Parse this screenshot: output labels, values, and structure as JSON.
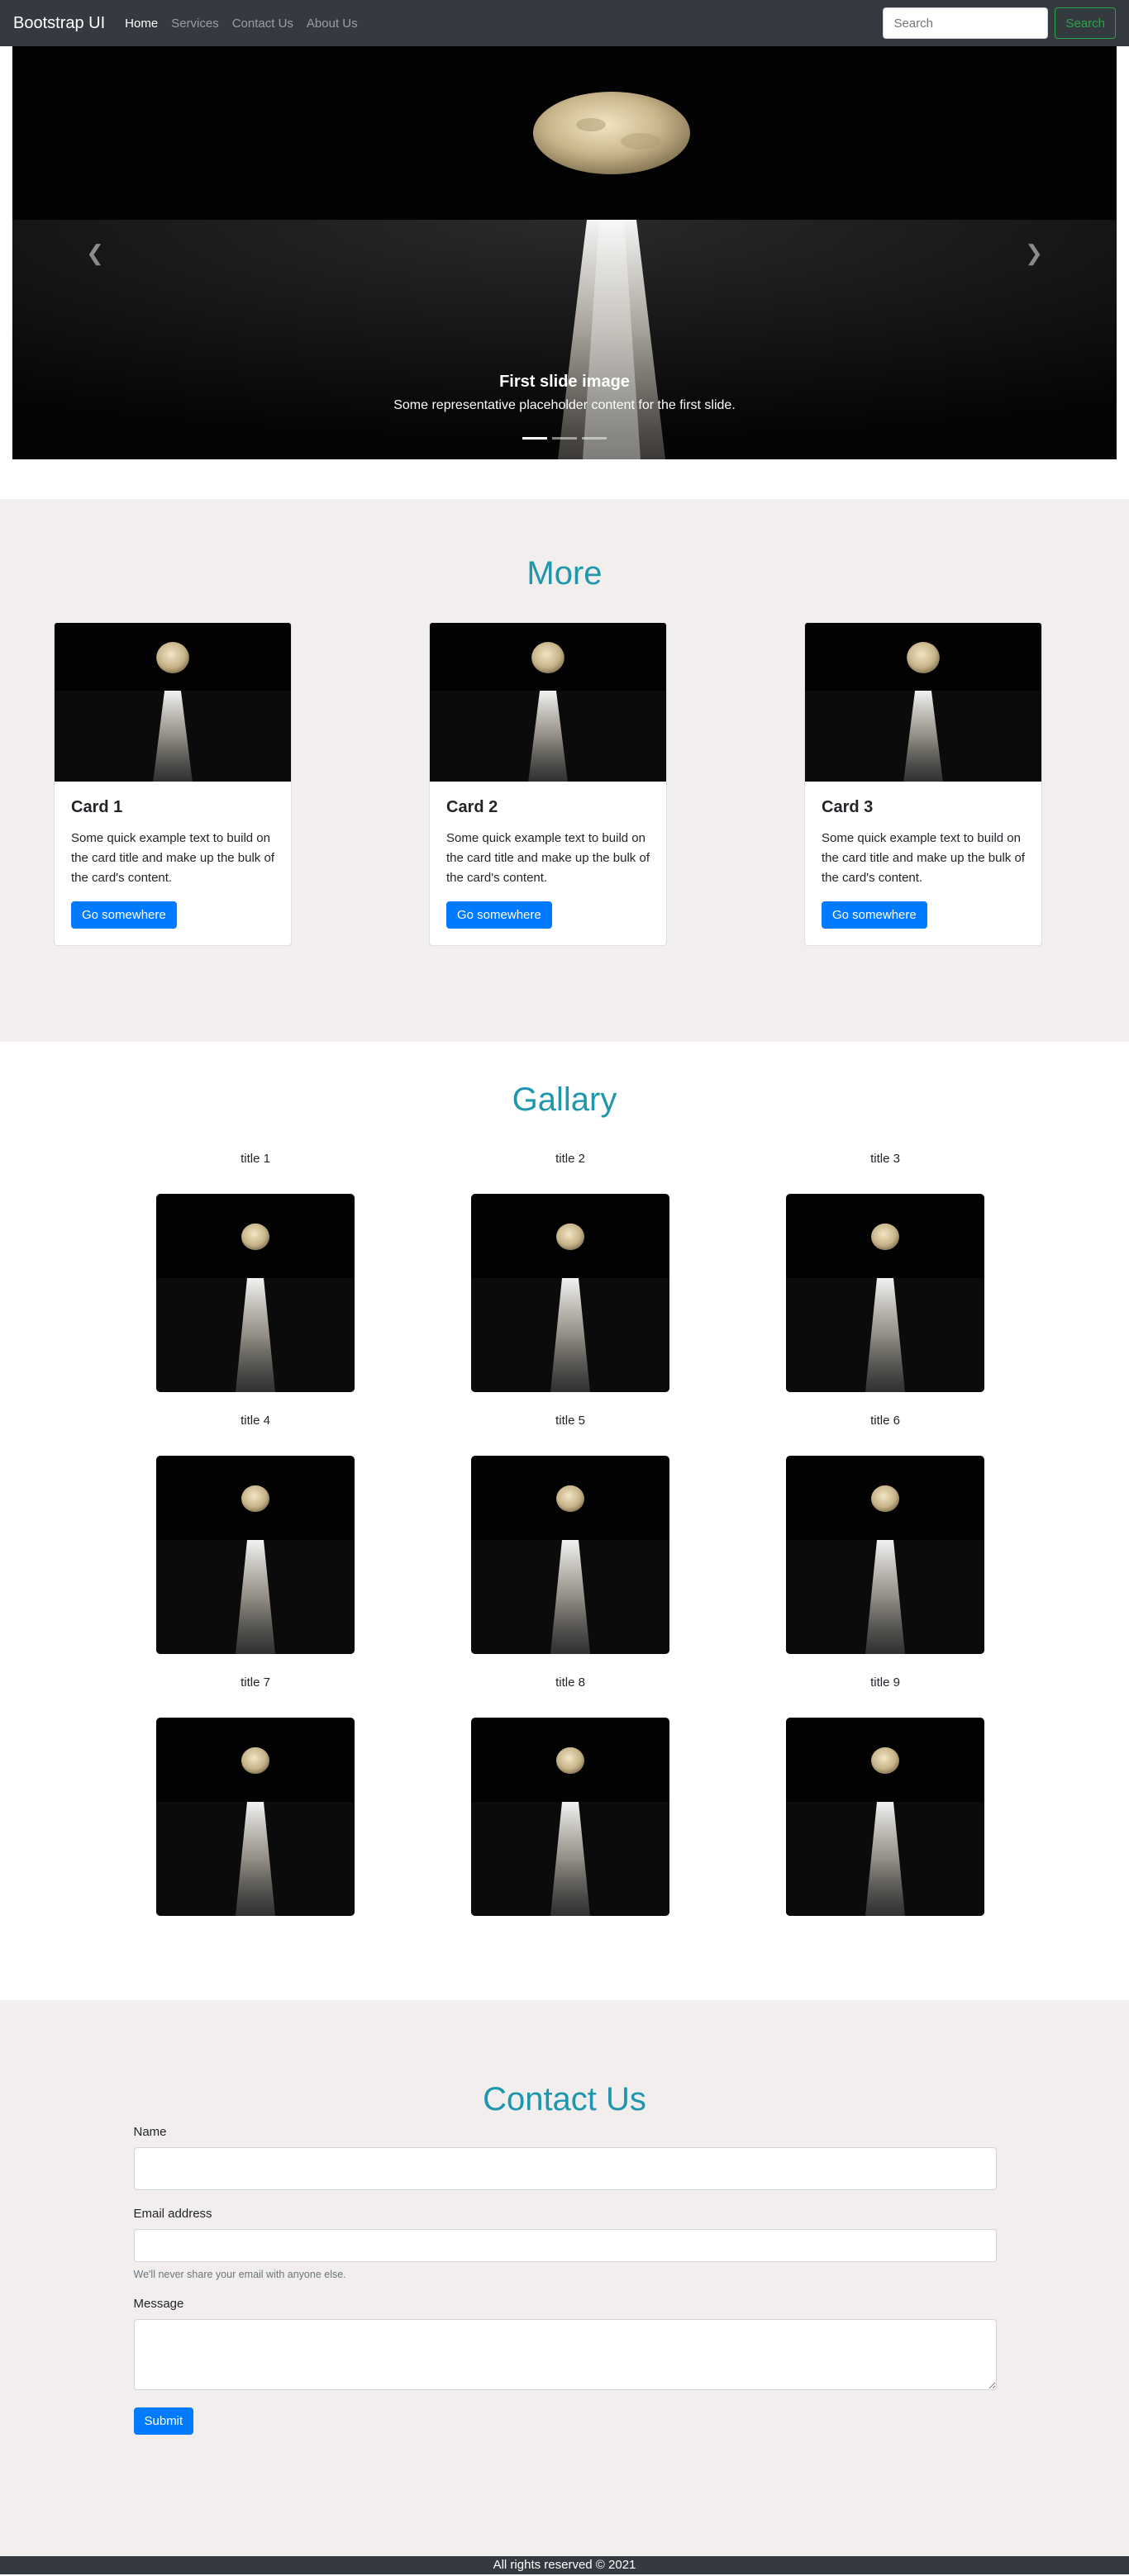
{
  "navbar": {
    "brand": "Bootstrap UI",
    "links": [
      {
        "label": "Home"
      },
      {
        "label": "Services"
      },
      {
        "label": "Contact Us"
      },
      {
        "label": "About Us"
      }
    ],
    "search_placeholder": "Search",
    "search_button": "Search"
  },
  "carousel": {
    "caption_title": "First slide image",
    "caption_text": "Some representative placeholder content for the first slide.",
    "prev_icon": "chevron-left-icon",
    "next_icon": "chevron-right-icon",
    "indicator_count": 3,
    "active_indicator": 0
  },
  "more": {
    "title": "More",
    "cards": [
      {
        "title": "Card 1",
        "text": "Some quick example text to build on the card title and make up the bulk of the card's content.",
        "button": "Go somewhere"
      },
      {
        "title": "Card 2",
        "text": "Some quick example text to build on the card title and make up the bulk of the card's content.",
        "button": "Go somewhere"
      },
      {
        "title": "Card 3",
        "text": "Some quick example text to build on the card title and make up the bulk of the card's content.",
        "button": "Go somewhere"
      }
    ]
  },
  "gallery": {
    "title": "Gallary",
    "items": [
      {
        "title": "title 1"
      },
      {
        "title": "title 2"
      },
      {
        "title": "title 3"
      },
      {
        "title": "title 4"
      },
      {
        "title": "title 5"
      },
      {
        "title": "title 6"
      },
      {
        "title": "title 7"
      },
      {
        "title": "title 8"
      },
      {
        "title": "title 9"
      }
    ]
  },
  "contact": {
    "title": "Contact Us",
    "name_label": "Name",
    "email_label": "Email address",
    "email_help": "We'll never share your email with anyone else.",
    "message_label": "Message",
    "submit": "Submit"
  },
  "footer": {
    "text": "All rights reserved © 2021"
  },
  "colors": {
    "navbar_bg": "#343a40",
    "accent": "#1e96ad",
    "primary": "#007bff",
    "success": "#28a745",
    "section_bg": "#f1eeed"
  }
}
